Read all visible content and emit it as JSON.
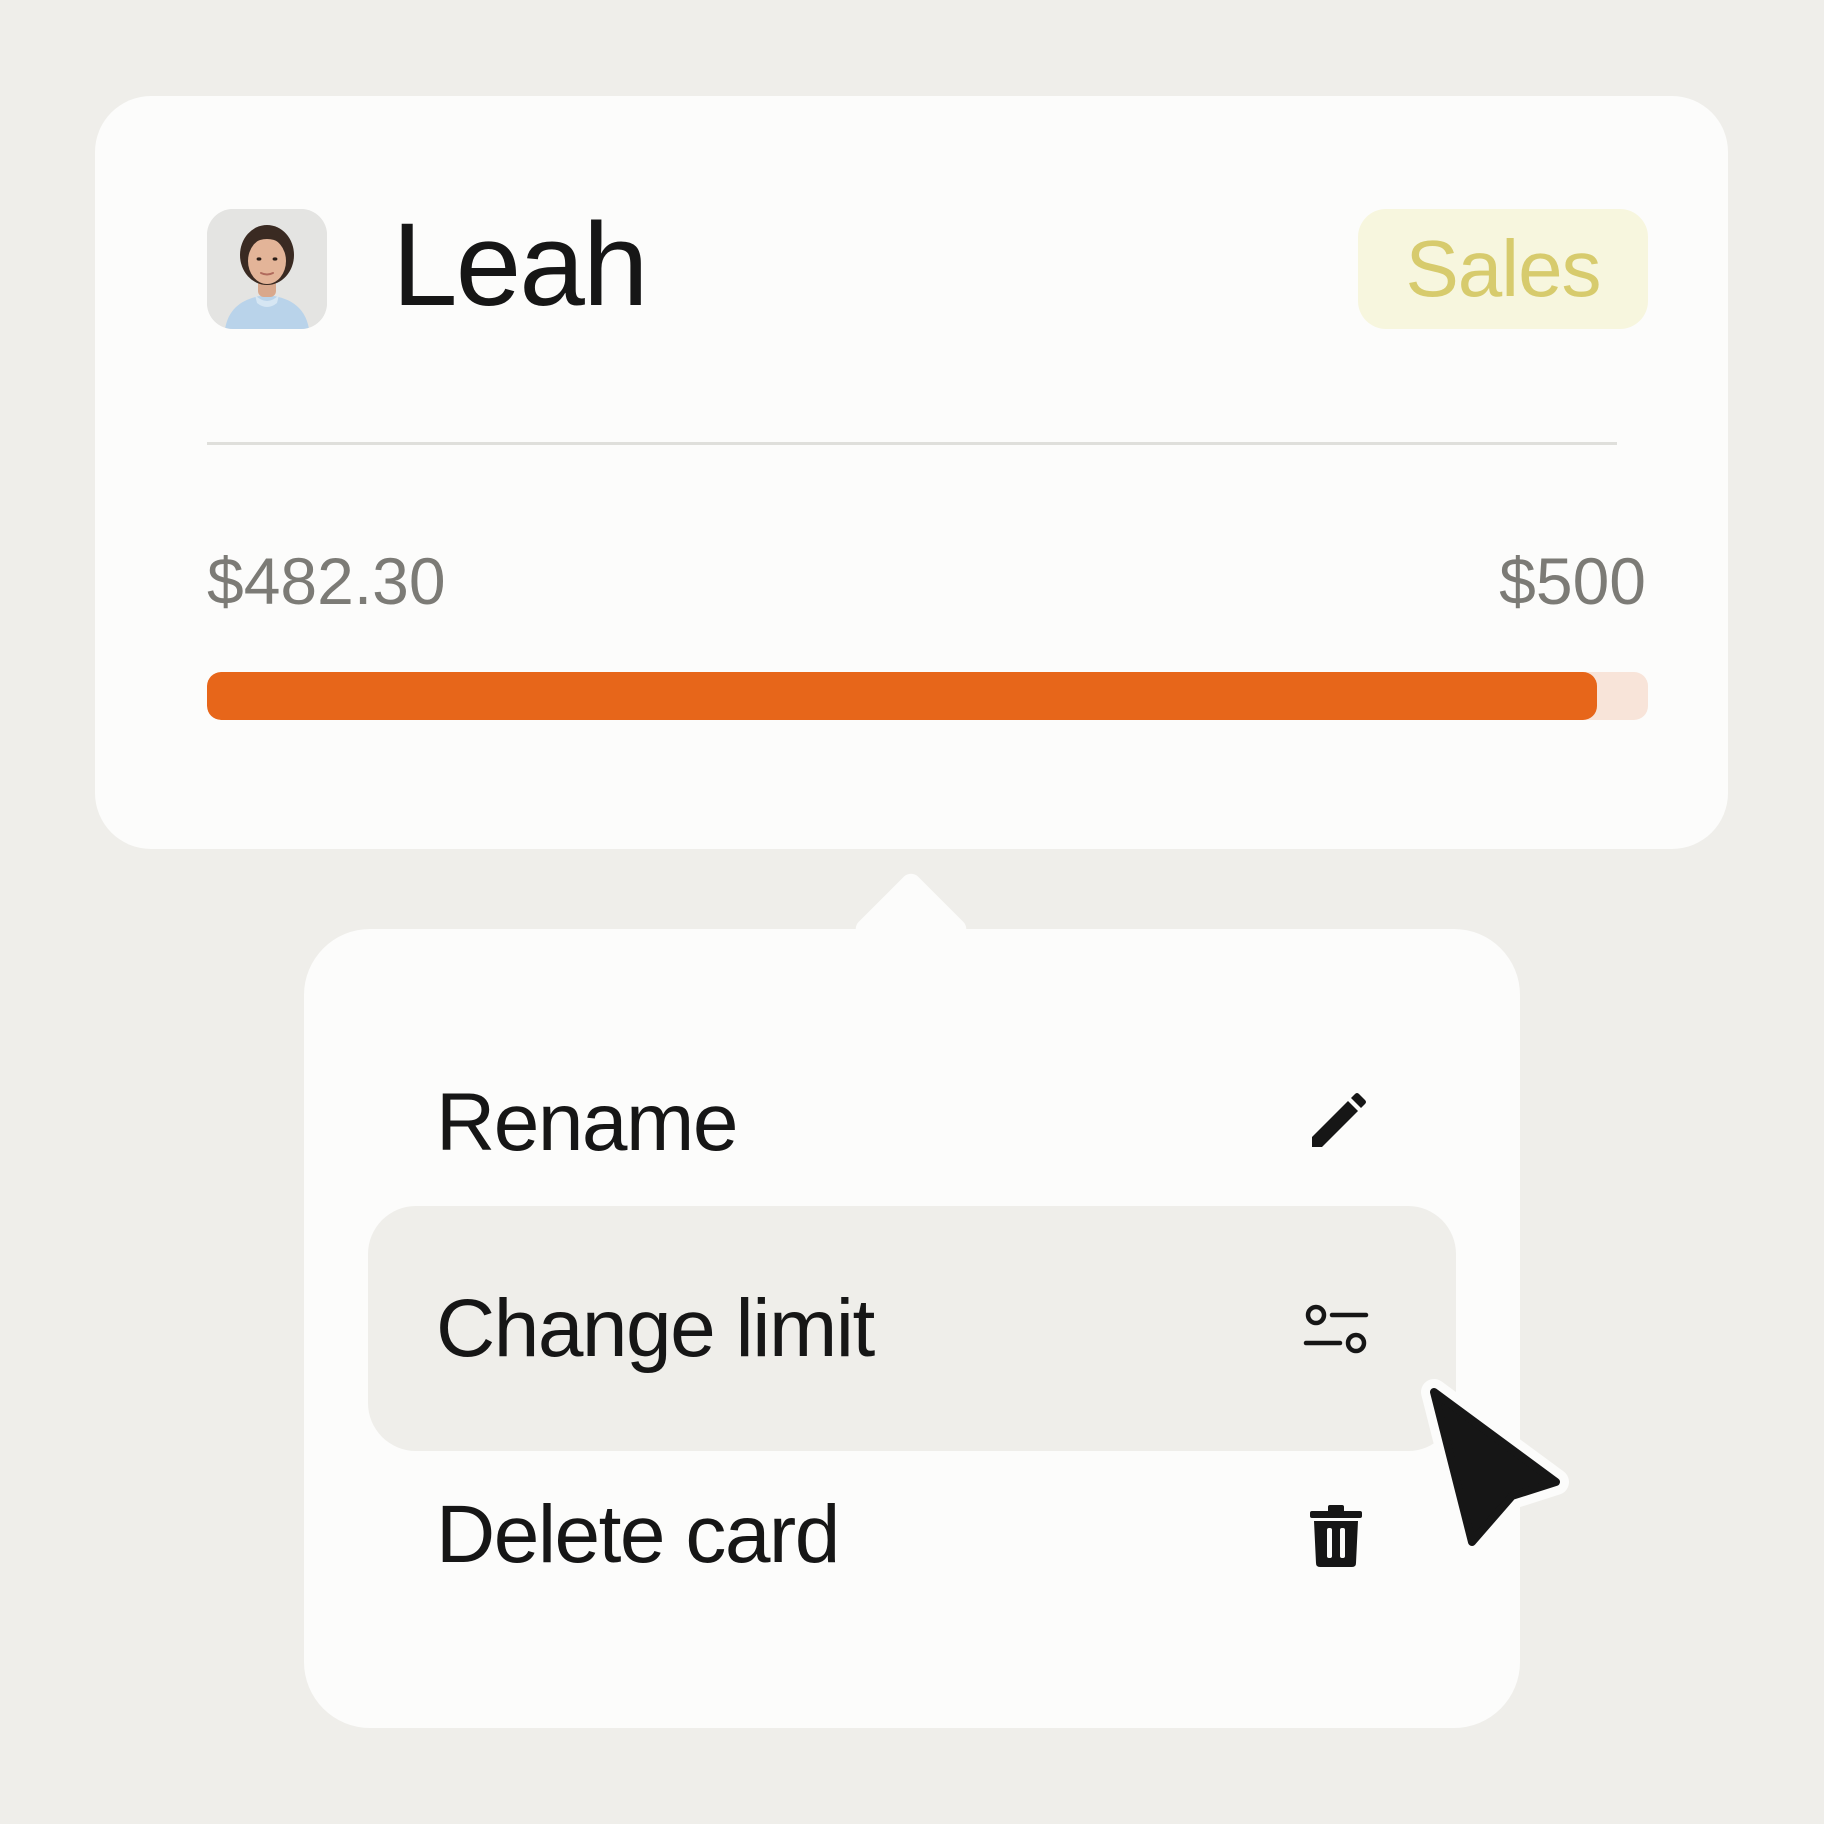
{
  "card": {
    "name": "Leah",
    "department_badge": "Sales",
    "spent": "$482.30",
    "limit": "$500",
    "progress_fraction": 0.9646,
    "colors": {
      "progress_fill": "#e7661a",
      "progress_track": "#f8e4d9",
      "badge_bg": "#f7f6de",
      "badge_text": "#d7cb6d"
    }
  },
  "menu": {
    "items": [
      {
        "label": "Rename",
        "icon": "pencil-icon"
      },
      {
        "label": "Change limit",
        "icon": "sliders-icon",
        "highlighted": true
      },
      {
        "label": "Delete card",
        "icon": "trash-icon"
      }
    ]
  },
  "cursor": {
    "icon": "arrow-pointer-icon"
  },
  "colors": {
    "background": "#efeeea",
    "surface": "#fcfcfb",
    "text": "#161616"
  }
}
